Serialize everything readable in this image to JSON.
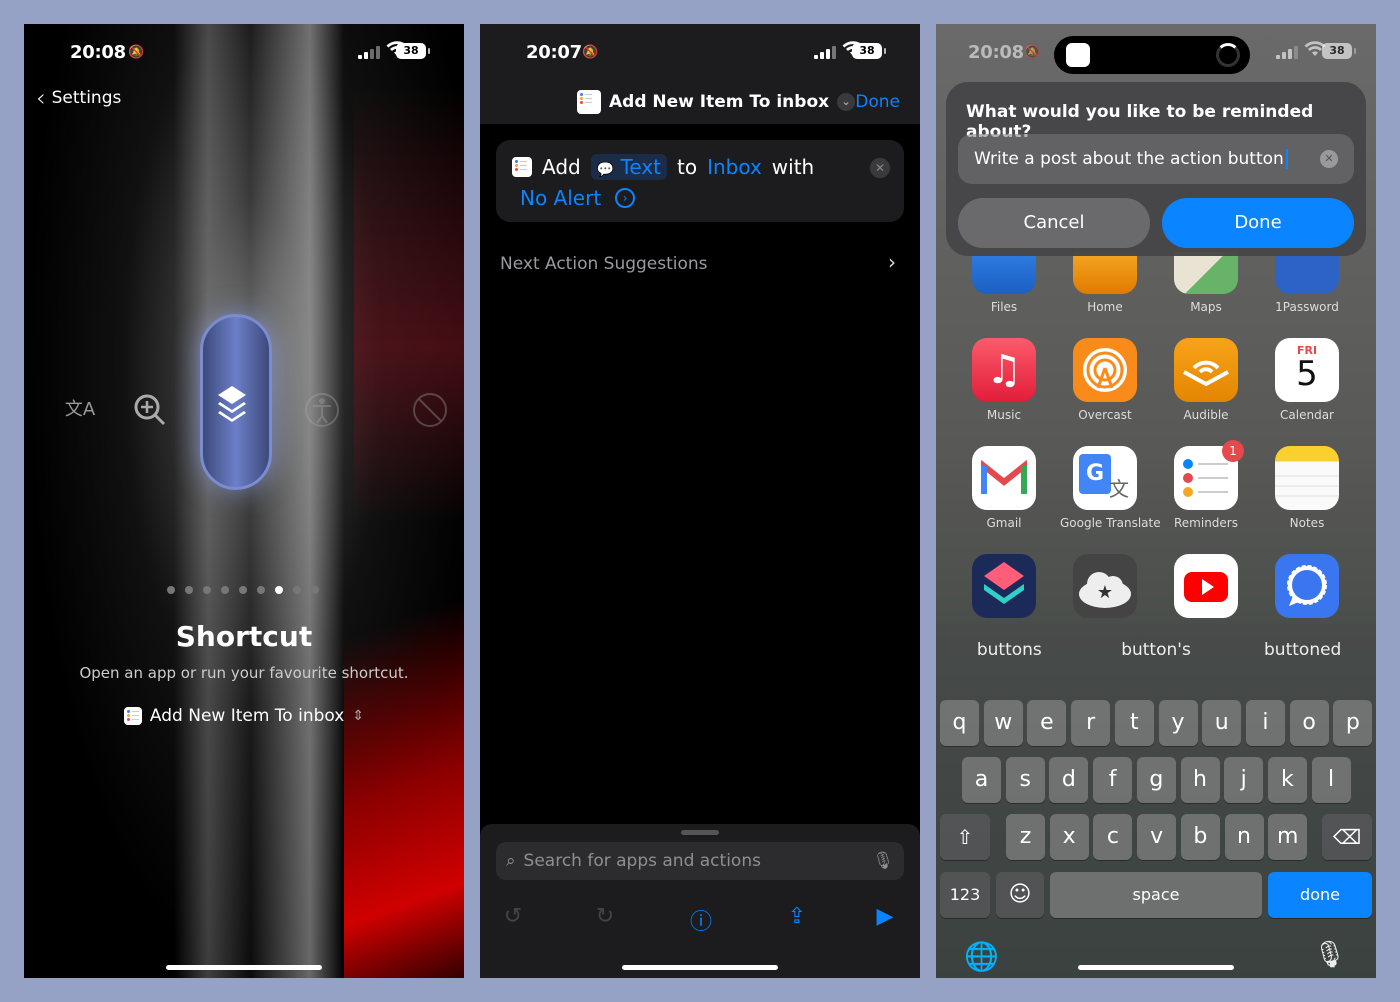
{
  "panel1": {
    "time": "20:08",
    "battery": "38",
    "back_label": "Settings",
    "title": "Shortcut",
    "subtitle": "Open an app or run your favourite shortcut.",
    "selected_shortcut": "Add New Item To inbox",
    "page_dots": {
      "count": 9,
      "active": 7
    }
  },
  "panel2": {
    "time": "20:07",
    "battery": "38",
    "title": "Add New Item To inbox",
    "done_label": "Done",
    "action": {
      "verb": "Add",
      "param_text": "Text",
      "to": "to",
      "param_list": "Inbox",
      "with": "with",
      "param_alert": "No Alert"
    },
    "next_suggestions": "Next Action Suggestions",
    "search_placeholder": "Search for apps and actions"
  },
  "panel3": {
    "time": "20:08",
    "battery": "38",
    "prompt": "What would you like to be reminded about?",
    "input_value": "Write a post about the action button",
    "cancel_label": "Cancel",
    "done_label": "Done",
    "apps_row0": [
      "Files",
      "Home",
      "Maps",
      "1Password"
    ],
    "apps_row1": [
      "Music",
      "Overcast",
      "Audible",
      "Calendar"
    ],
    "apps_row2": [
      "Gmail",
      "Google Translate",
      "Reminders",
      "Notes"
    ],
    "calendar_day": "FRI",
    "calendar_date": "5",
    "reminders_badge": "1",
    "suggestions": [
      "buttons",
      "button's",
      "buttoned"
    ],
    "keys_row1": [
      "q",
      "w",
      "e",
      "r",
      "t",
      "y",
      "u",
      "i",
      "o",
      "p"
    ],
    "keys_row2": [
      "a",
      "s",
      "d",
      "f",
      "g",
      "h",
      "j",
      "k",
      "l"
    ],
    "keys_row3": [
      "z",
      "x",
      "c",
      "v",
      "b",
      "n",
      "m"
    ],
    "key_123": "123",
    "key_space": "space",
    "key_done": "done"
  },
  "colors": {
    "accent": "#0a84ff",
    "page_bg": "#96a1c6"
  }
}
